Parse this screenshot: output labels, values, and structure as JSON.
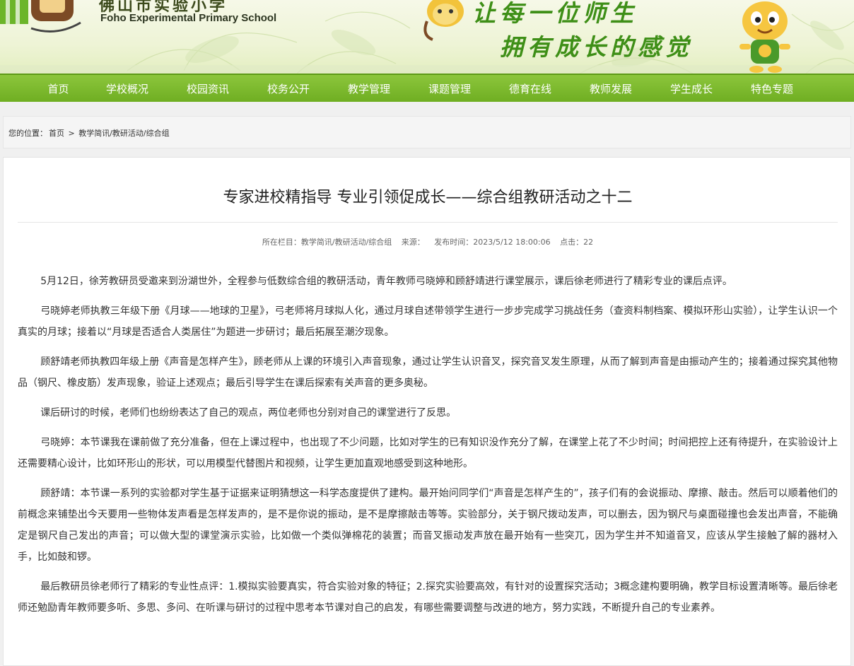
{
  "header": {
    "school_cn": "佛山市实验小学",
    "school_en": "Foho Experimental Primary School",
    "slogan_line1": "让每一位师生",
    "slogan_line2": "拥有成长的感觉"
  },
  "nav": {
    "items": [
      {
        "label": "首页"
      },
      {
        "label": "学校概况"
      },
      {
        "label": "校园资讯"
      },
      {
        "label": "校务公开"
      },
      {
        "label": "教学管理"
      },
      {
        "label": "课题管理"
      },
      {
        "label": "德育在线"
      },
      {
        "label": "教师发展"
      },
      {
        "label": "学生成长"
      },
      {
        "label": "特色专题"
      }
    ]
  },
  "breadcrumb": {
    "prefix": "您的位置：",
    "home": "首页",
    "sep": ">",
    "path": "教学简讯/教研活动/综合组"
  },
  "article": {
    "title": "专家进校精指导 专业引领促成长——综合组教研活动之十二",
    "meta": {
      "column": "所在栏目：教学简讯/教研活动/综合组",
      "source": "来源：",
      "published": "发布时间：2023/5/12 18:00:06",
      "clicks": "点击：22"
    },
    "paragraphs": [
      "5月12日，徐芳教研员受邀来到汾湖世外，全程参与低数综合组的教研活动，青年教师弓晓婷和顾舒靖进行课堂展示，课后徐老师进行了精彩专业的课后点评。",
      "弓晓婷老师执教三年级下册《月球——地球的卫星》，弓老师将月球拟人化，通过月球自述带领学生进行一步步完成学习挑战任务（查资料制档案、模拟环形山实验），让学生认识一个真实的月球；接着以“月球是否适合人类居住”为题进一步研讨；最后拓展至潮汐现象。",
      "顾舒靖老师执教四年级上册《声音是怎样产生》，顾老师从上课的环境引入声音现象，通过让学生认识音叉，探究音叉发生原理，从而了解到声音是由振动产生的；接着通过探究其他物品（钢尺、橡皮筋）发声现象，验证上述观点；最后引导学生在课后探索有关声音的更多奥秘。",
      "课后研讨的时候，老师们也纷纷表达了自己的观点，两位老师也分别对自己的课堂进行了反思。",
      "弓晓婷：本节课我在课前做了充分准备，但在上课过程中，也出现了不少问题，比如对学生的已有知识没作充分了解，在课堂上花了不少时间；时间把控上还有待提升，在实验设计上还需要精心设计，比如环形山的形状，可以用模型代替图片和视频，让学生更加直观地感受到这种地形。",
      "顾舒靖：本节课一系列的实验都对学生基于证据来证明猜想这一科学态度提供了建构。最开始问同学们“声音是怎样产生的”，孩子们有的会说振动、摩擦、敲击。然后可以顺着他们的前概念来铺垫出今天要用一些物体发声看是怎样发声的，是不是你说的振动，是不是摩擦敲击等等。实验部分，关于钢尺拨动发声，可以删去，因为钢尺与桌面碰撞也会发出声音，不能确定是钢尺自己发出的声音；可以做大型的课堂演示实验，比如做一个类似弹棉花的装置；而音叉振动发声放在最开始有一些突兀，因为学生并不知道音叉，应该从学生接触了解的器材入手，比如鼓和锣。",
      "最后教研员徐老师行了精彩的专业性点评：1.模拟实验要真实，符合实验对象的特征；2.探究实验要高效，有针对的设置探究活动；3概念建构要明确，教学目标设置清晰等。最后徐老师还勉励青年教师要多听、多思、多问、在听课与研讨的过程中思考本节课对自己的启发，有哪些需要调整与改进的地方，努力实践，不断提升自己的专业素养。"
    ]
  }
}
